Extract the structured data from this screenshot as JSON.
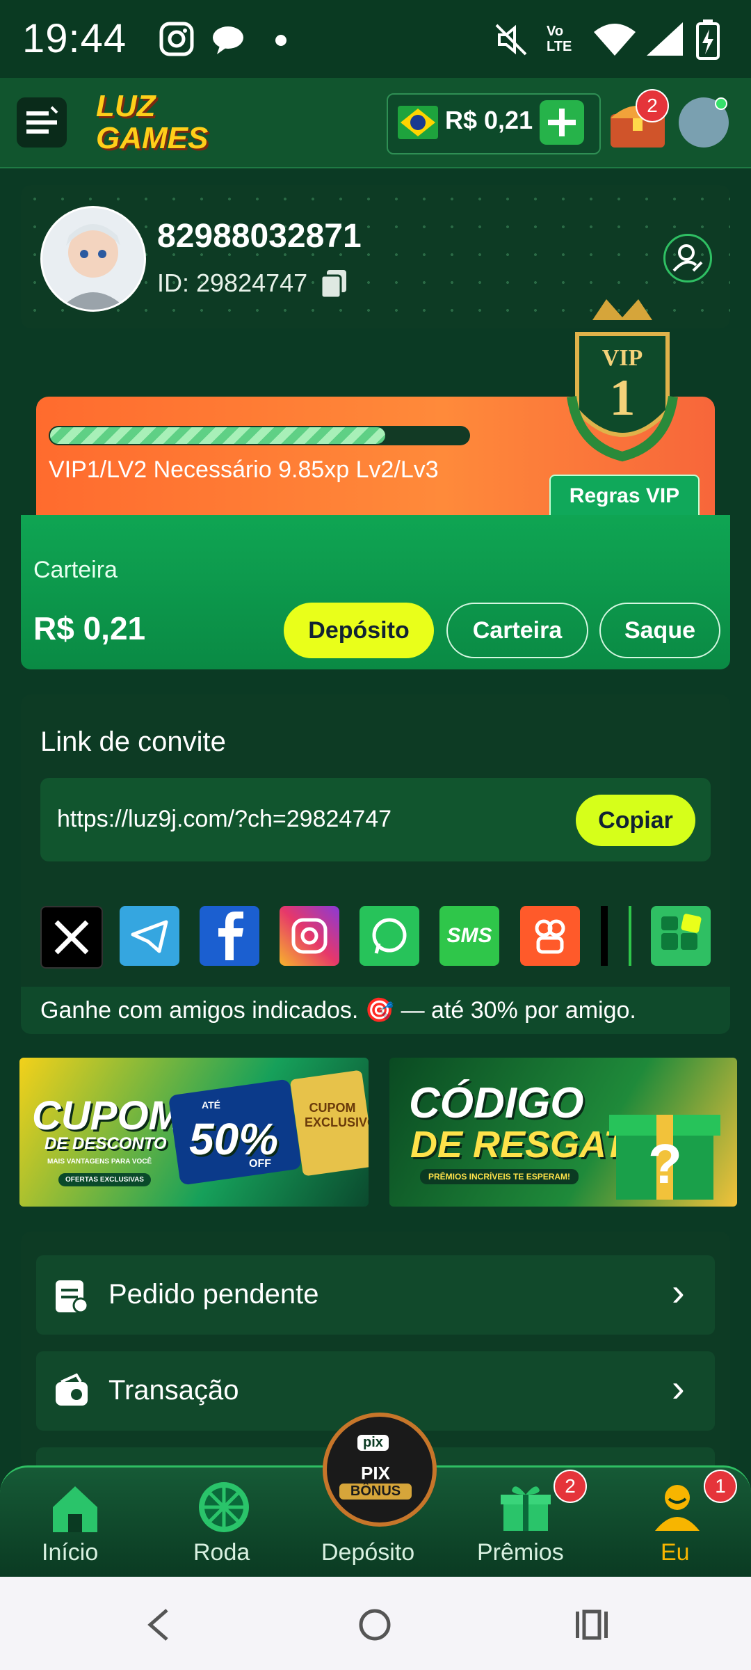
{
  "status_bar": {
    "time": "19:44"
  },
  "header": {
    "logo_text": "LUZ GAMES",
    "balance": "R$ 0,21",
    "chest_badge": "2",
    "country_flag": "brazil-flag-icon"
  },
  "profile": {
    "username": "82988032871",
    "id_label": "ID: 29824747"
  },
  "vip": {
    "badge_label": "VIP",
    "badge_level": "1",
    "progress_fraction": 0.8,
    "level_text": "VIP1/LV2  Necessário 9.85xp Lv2/Lv3",
    "rules_button": "Regras VIP"
  },
  "wallet": {
    "label": "Carteira",
    "amount": "R$ 0,21",
    "deposit_button": "Depósito",
    "wallet_button": "Carteira",
    "withdraw_button": "Saque"
  },
  "invite": {
    "title": "Link de convite",
    "url": "https://luz9j.com/?ch=29824747",
    "copy_button": "Copiar",
    "share_icons": [
      "x-icon",
      "telegram-icon",
      "facebook-icon",
      "instagram-icon",
      "whatsapp-icon",
      "sms-icon",
      "kwai-icon",
      "tiktok-icon",
      "more-apps-icon"
    ],
    "sms_label": "SMS",
    "footer_text": "Ganhe com amigos indicados. 🎯 — até 30% por amigo."
  },
  "banners": {
    "coupon_title": "CUPOM",
    "coupon_subtitle": "DE DESCONTO",
    "coupon_upto": "ATÉ",
    "coupon_percent": "50%",
    "coupon_off": "OFF",
    "coupon_exclusive": "CUPOM EXCLUSIVO",
    "coupon_small": "MAIS VANTAGENS PARA VOCÊ",
    "coupon_offers": "OFERTAS EXCLUSIVAS",
    "code_title_1": "CÓDIGO",
    "code_title_2": "DE RESGATE",
    "code_tagline": "PRÊMIOS INCRÍVEIS TE ESPERAM!"
  },
  "menu": [
    {
      "label": "Pedido pendente"
    },
    {
      "label": "Transação"
    }
  ],
  "bottom_nav": {
    "items": [
      "Início",
      "Roda",
      "Depósito",
      "Prêmios",
      "Eu"
    ],
    "center_label_1": "PIX",
    "center_label_2": "BÔNUS",
    "center_top": "pix",
    "premios_badge": "2",
    "eu_badge": "1"
  },
  "colors": {
    "primary_green": "#0fa553",
    "deposit_yellow": "#e9ff1a",
    "active_nav": "#f7b500",
    "badge_red": "#e5343a"
  }
}
